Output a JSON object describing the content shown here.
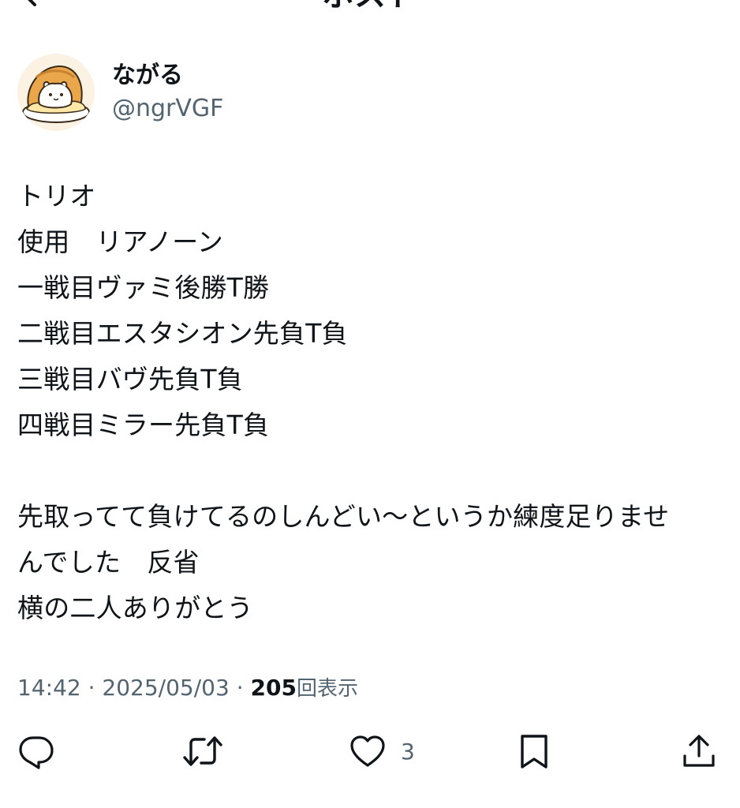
{
  "header": {
    "title": "ポスト"
  },
  "author": {
    "display_name": "ながる",
    "handle": "@ngrVGF"
  },
  "tweet": {
    "lines": [
      "トリオ",
      "使用　リアノーン",
      "一戦目ヴァミ後勝T勝",
      "二戦目エスタシオン先負T負",
      "三戦目バヴ先負T負",
      "四戦目ミラー先負T負",
      "",
      "先取ってて負けてるのしんどい〜というか練度足りませ",
      "んでした　反省",
      "横の二人ありがとう"
    ]
  },
  "meta": {
    "time": "14:42",
    "separator": "·",
    "date": "2025/05/03",
    "views_count": "205",
    "views_label": "回表示"
  },
  "actions": {
    "like_count": "3"
  },
  "icons": {
    "back": "back-arrow-icon",
    "more": "more-icon",
    "reply": "reply-icon",
    "retweet": "retweet-icon",
    "like": "heart-icon",
    "bookmark": "bookmark-icon",
    "share": "share-icon"
  },
  "colors": {
    "text": "#0f1419",
    "secondary": "#536471",
    "background": "#ffffff"
  }
}
